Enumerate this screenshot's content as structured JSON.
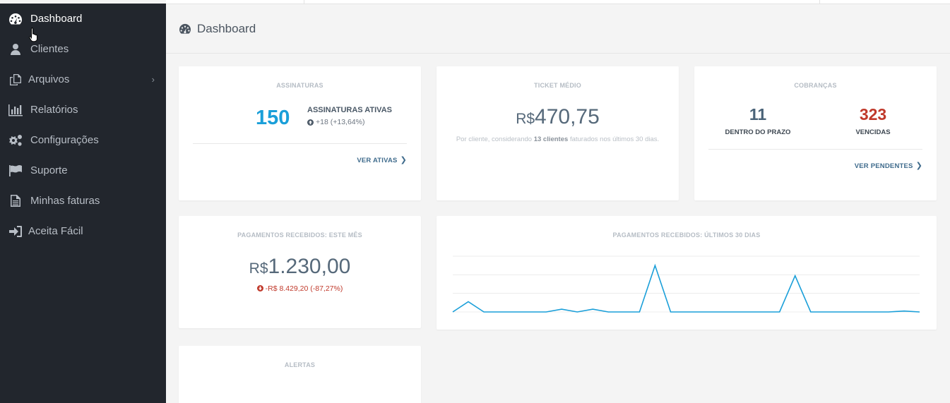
{
  "sidebar": {
    "items": [
      {
        "label": "Dashboard",
        "icon": "dashboard-gauge-icon"
      },
      {
        "label": "Clientes",
        "icon": "user-icon"
      },
      {
        "label": "Arquivos",
        "icon": "files-icon",
        "chevron": "›"
      },
      {
        "label": "Relatórios",
        "icon": "bar-chart-icon"
      },
      {
        "label": "Configurações",
        "icon": "gears-icon"
      },
      {
        "label": "Suporte",
        "icon": "flag-icon"
      },
      {
        "label": "Minhas faturas",
        "icon": "document-icon"
      },
      {
        "label": "Aceita Fácil",
        "icon": "sign-in-icon"
      }
    ]
  },
  "header": {
    "title": "Dashboard"
  },
  "assinaturas": {
    "title": "ASSINATURAS",
    "count": "150",
    "label": "ASSINATURAS ATIVAS",
    "change": "+18 (+13,64%)",
    "link": "VER ATIVAS"
  },
  "ticket": {
    "title": "TICKET MÉDIO",
    "currency": "R$",
    "value": "470,75",
    "note_pre": "Por cliente, considerando",
    "note_bold": "13 clientes",
    "note_post": "faturados nos últimos 30 dias."
  },
  "cobrancas": {
    "title": "COBRANÇAS",
    "on_time_count": "11",
    "on_time_label": "DENTRO DO PRAZO",
    "overdue_count": "323",
    "overdue_label": "VENCIDAS",
    "link": "VER PENDENTES"
  },
  "pagamentos_mes": {
    "title": "PAGAMENTOS RECEBIDOS: ESTE MÊS",
    "currency": "R$",
    "value": "1.230,00",
    "change": "-R$ 8.429,20 (-87,27%)"
  },
  "pagamentos_30": {
    "title": "PAGAMENTOS RECEBIDOS: ÚLTIMOS 30 DIAS"
  },
  "alertas": {
    "title": "ALERTAS"
  },
  "colors": {
    "accent_blue": "#1a9fd9",
    "overdue_red": "#c0392b",
    "on_time_slate": "#4a6378",
    "sidebar_bg": "#22262d"
  },
  "chart_data": {
    "type": "line",
    "title": "PAGAMENTOS RECEBIDOS: ÚLTIMOS 30 DIAS",
    "xlabel": "",
    "ylabel": "",
    "grid": true,
    "ylim": [
      0,
      3
    ],
    "series": [
      {
        "values": [
          0,
          0.55,
          0,
          0,
          0,
          0,
          0,
          0.15,
          0,
          0.15,
          0,
          0,
          0,
          2.5,
          0,
          0,
          0,
          0,
          0,
          0,
          0,
          0,
          1.95,
          0,
          0,
          0,
          0,
          0,
          0,
          0.05,
          0
        ]
      }
    ]
  }
}
